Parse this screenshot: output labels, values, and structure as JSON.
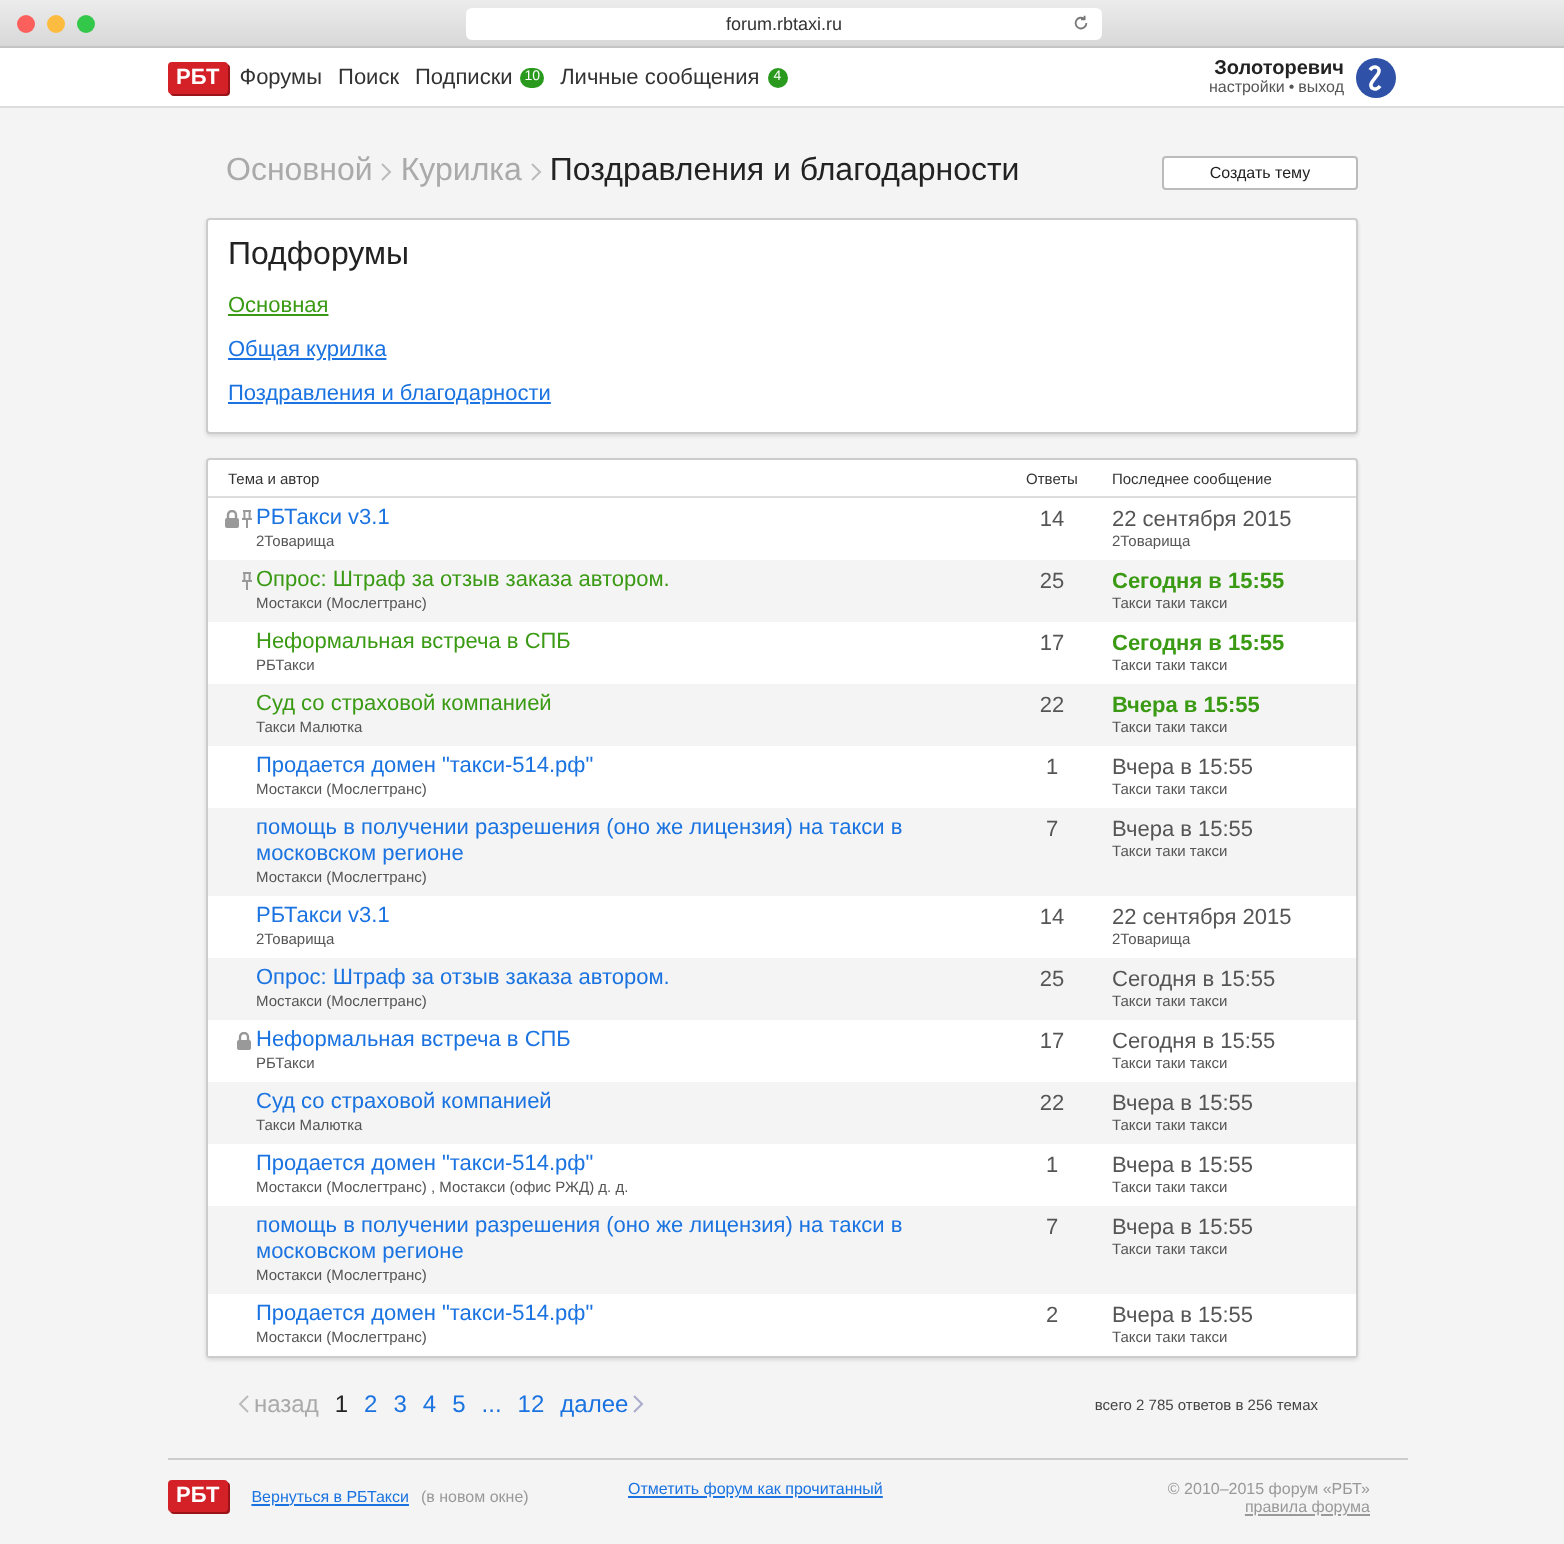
{
  "browser": {
    "url": "forum.rbtaxi.ru"
  },
  "nav": {
    "logo": "РБТ",
    "items": [
      {
        "label": "Форумы"
      },
      {
        "label": "Поиск"
      },
      {
        "label": "Подписки",
        "badge": "10"
      },
      {
        "label": "Личные сообщения",
        "badge": "4"
      }
    ],
    "user": {
      "name": "Золоторевич",
      "settings": "настройки",
      "separator": "•",
      "logout": "выход"
    }
  },
  "breadcrumbs": [
    {
      "label": "Основной",
      "current": false
    },
    {
      "label": "Курилка",
      "current": false
    },
    {
      "label": "Поздравления и благодарности",
      "current": true
    }
  ],
  "create_button": "Создать тему",
  "subforums": {
    "title": "Подфорумы",
    "items": [
      {
        "label": "Основная",
        "unread": true
      },
      {
        "label": "Общая курилка",
        "unread": false
      },
      {
        "label": "Поздравления и благодарности",
        "unread": false
      }
    ]
  },
  "table": {
    "columns": [
      "Тема и автор",
      "Ответы",
      "Последнее сообщение"
    ],
    "rows": [
      {
        "title": "РБТакси v3.1",
        "author": "2Товарища",
        "replies": "14",
        "last": "22 сентября 2015",
        "last_author": "2Товарища",
        "unread": false,
        "locked": true,
        "pinned": true
      },
      {
        "title": "Опрос: Штраф за отзыв заказа автором.",
        "author": "Мостакси (Мослегтранс)",
        "replies": "25",
        "last": "Сегодня в 15:55",
        "last_author": "Такси таки такси",
        "unread": true,
        "locked": false,
        "pinned": true
      },
      {
        "title": "Неформальная встреча в СПБ",
        "author": "РБТакси",
        "replies": "17",
        "last": "Сегодня в 15:55",
        "last_author": "Такси таки такси",
        "unread": true,
        "locked": false,
        "pinned": false
      },
      {
        "title": "Суд со страховой компанией",
        "author": "Такси Малютка",
        "replies": "22",
        "last": "Вчера в 15:55",
        "last_author": "Такси таки такси",
        "unread": true,
        "locked": false,
        "pinned": false
      },
      {
        "title": "Продается домен \"такси-514.рф\"",
        "author": "Мостакси (Мослегтранс)",
        "replies": "1",
        "last": "Вчера в 15:55",
        "last_author": "Такси таки такси",
        "unread": false,
        "locked": false,
        "pinned": false
      },
      {
        "title": "помощь в получении разрешения (оно же лицензия) на такси в московском регионе",
        "author": "Мостакси (Мослегтранс)",
        "replies": "7",
        "last": "Вчера в 15:55",
        "last_author": "Такси таки такси",
        "unread": false,
        "locked": false,
        "pinned": false
      },
      {
        "title": "РБТакси v3.1",
        "author": "2Товарища",
        "replies": "14",
        "last": "22 сентября 2015",
        "last_author": "2Товарища",
        "unread": false,
        "locked": false,
        "pinned": false
      },
      {
        "title": "Опрос: Штраф за отзыв заказа автором.",
        "author": "Мостакси (Мослегтранс)",
        "replies": "25",
        "last": "Сегодня в 15:55",
        "last_author": "Такси таки такси",
        "unread": false,
        "locked": false,
        "pinned": false
      },
      {
        "title": "Неформальная встреча в СПБ",
        "author": "РБТакси",
        "replies": "17",
        "last": "Сегодня в 15:55",
        "last_author": "Такси таки такси",
        "unread": false,
        "locked": true,
        "pinned": false
      },
      {
        "title": "Суд со страховой компанией",
        "author": "Такси Малютка",
        "replies": "22",
        "last": "Вчера в 15:55",
        "last_author": "Такси таки такси",
        "unread": false,
        "locked": false,
        "pinned": false
      },
      {
        "title": "Продается домен \"такси-514.рф\"",
        "author": "Мостакси (Мослегтранс) , Мостакси (офис РЖД) д. д.",
        "replies": "1",
        "last": "Вчера в 15:55",
        "last_author": "Такси таки такси",
        "unread": false,
        "locked": false,
        "pinned": false
      },
      {
        "title": "помощь в получении разрешения (оно же лицензия) на такси в московском регионе",
        "author": "Мостакси (Мослегтранс)",
        "replies": "7",
        "last": "Вчера в 15:55",
        "last_author": "Такси таки такси",
        "unread": false,
        "locked": false,
        "pinned": false
      },
      {
        "title": "Продается домен \"такси-514.рф\"",
        "author": "Мостакси (Мослегтранс)",
        "replies": "2",
        "last": "Вчера в 15:55",
        "last_author": "Такси таки такси",
        "unread": false,
        "locked": false,
        "pinned": false
      }
    ]
  },
  "pagination": {
    "prev": {
      "label": "назад",
      "disabled": true
    },
    "pages": [
      {
        "label": "1",
        "selected": true
      },
      {
        "label": "2",
        "selected": false
      },
      {
        "label": "3",
        "selected": false
      },
      {
        "label": "4",
        "selected": false
      },
      {
        "label": "5",
        "selected": false
      },
      {
        "label": "...",
        "selected": false
      },
      {
        "label": "12",
        "selected": false
      }
    ],
    "next": {
      "label": "далее",
      "disabled": false
    },
    "summary": "всего 2 785 ответов в 256 темах"
  },
  "footer": {
    "logo": "РБТ",
    "back_link": "Вернуться в РБТакси",
    "back_note": "(в новом окне)",
    "mark_read": "Отметить форум как прочитанный",
    "copyright": "© 2010–2015 форум «РБТ»",
    "rules": "правила форума"
  }
}
